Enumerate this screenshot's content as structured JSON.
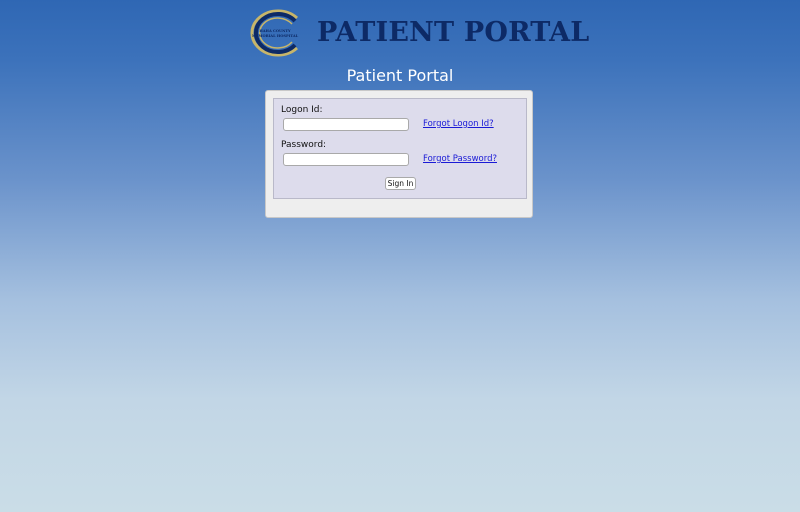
{
  "header": {
    "logo_lines": [
      "HAHA COUNTY",
      "MEMORIAL HOSPITAL"
    ],
    "title": "PATIENT PORTAL"
  },
  "page": {
    "subtitle": "Patient Portal"
  },
  "login": {
    "logon_label": "Logon Id:",
    "logon_value": "",
    "forgot_logon": "Forgot Logon Id?",
    "password_label": "Password:",
    "password_value": "",
    "forgot_password": "Forgot Password?",
    "signin_label": "Sign In"
  },
  "colors": {
    "title": "#0d2a66",
    "link": "#1a1ad6",
    "form_background": "#dddcec",
    "logo_ring_gold": "#c7b56a",
    "logo_ring_navy": "#0d2a66"
  }
}
